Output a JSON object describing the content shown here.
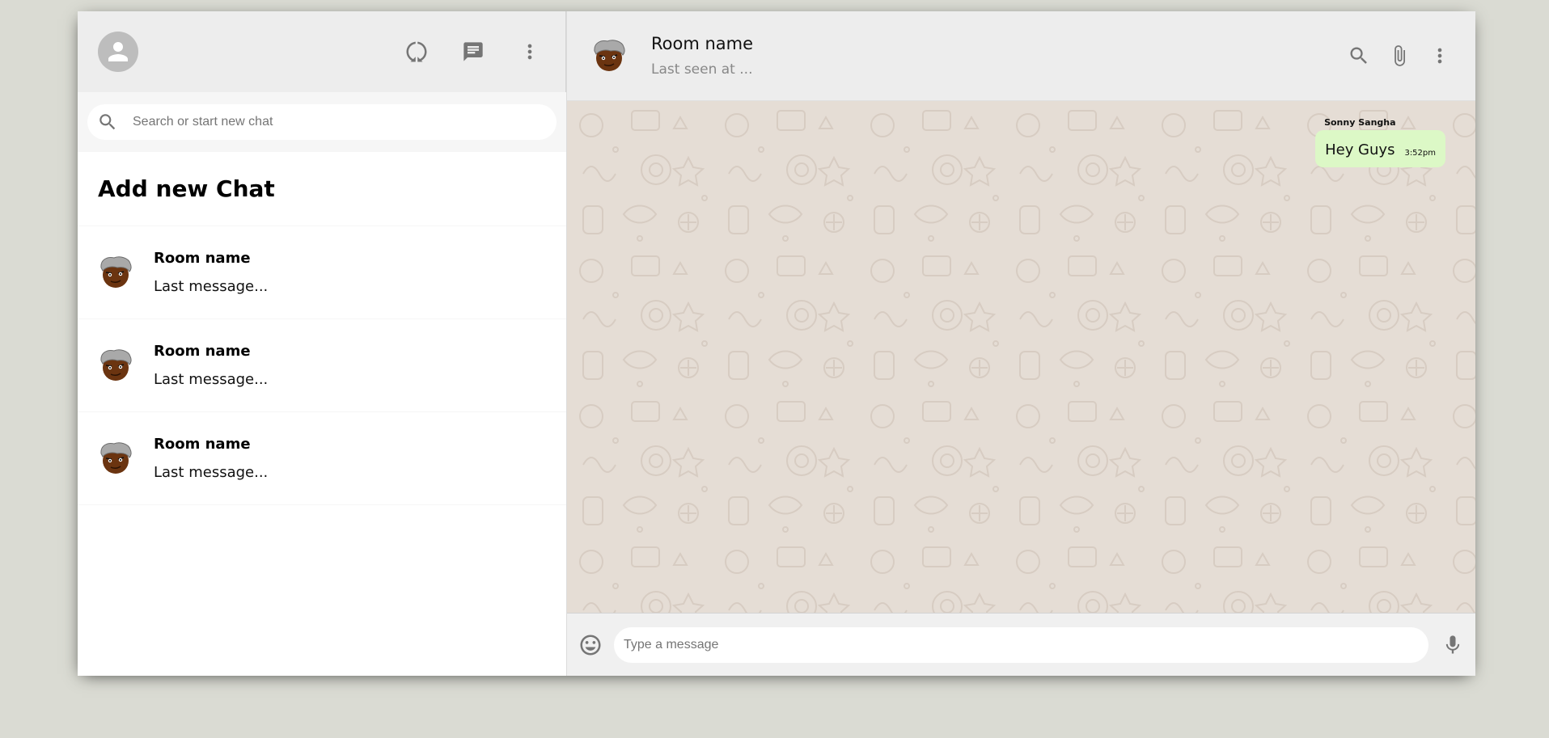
{
  "sidebar": {
    "header": {
      "avatar_icon": "person-icon",
      "icons": [
        "status-icon",
        "chat-icon",
        "more-vert-icon"
      ]
    },
    "search": {
      "icon": "search-icon",
      "placeholder": "Search or start new chat"
    },
    "add_new_chat": "Add new Chat",
    "rooms": [
      {
        "name": "Room name",
        "last_message": "Last message..."
      },
      {
        "name": "Room name",
        "last_message": "Last message..."
      },
      {
        "name": "Room name",
        "last_message": "Last message..."
      }
    ]
  },
  "chat": {
    "header": {
      "title": "Room name",
      "subtitle": "Last seen at ...",
      "icons": [
        "search-icon",
        "attach-icon",
        "more-vert-icon"
      ]
    },
    "messages": [
      {
        "name": "Sonny Sangha",
        "text": "Hey Guys",
        "time": "3:52pm"
      }
    ],
    "footer": {
      "emoji_icon": "emoji-icon",
      "placeholder": "Type a message",
      "mic_icon": "mic-icon"
    }
  },
  "colors": {
    "page_bg": "#dadbd3",
    "header_bg": "#ededed",
    "chat_bg": "#e5ddd5",
    "sent_bubble": "#dcf8c6"
  }
}
